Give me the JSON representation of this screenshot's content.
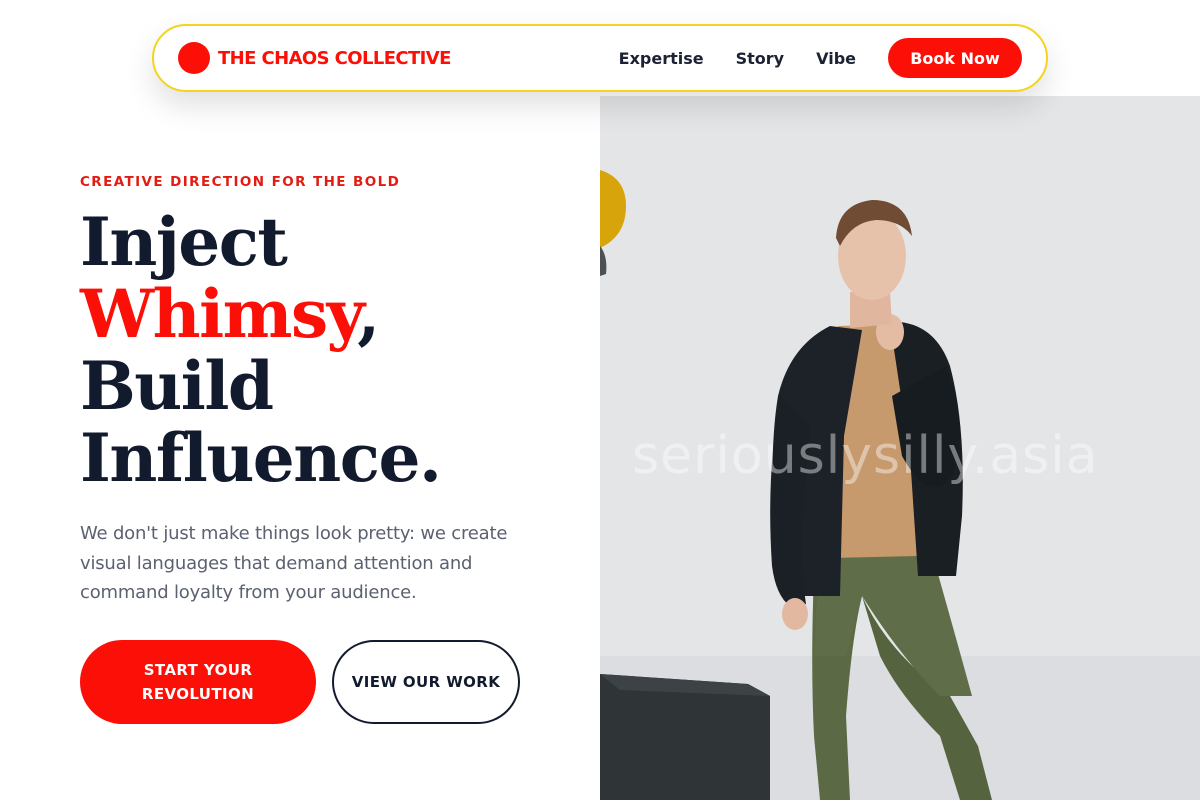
{
  "nav": {
    "brand": "THE CHAOS COLLECTIVE",
    "links": [
      "Expertise",
      "Story",
      "Vibe"
    ],
    "cta": "Book Now"
  },
  "hero": {
    "eyebrow": "CREATIVE DIRECTION FOR THE BOLD",
    "headline": {
      "line1": "Inject",
      "accent": "Whimsy",
      "accent_suffix": ",",
      "line3": "Build",
      "line4": "Influence."
    },
    "lede": "We don't just make things look pretty: we create visual languages that demand attention and command loyalty from your audience.",
    "primary_cta": "START YOUR REVOLUTION",
    "secondary_cta": "VIEW OUR WORK"
  },
  "photo": {
    "watermark": "seriouslysilly.asia"
  },
  "colors": {
    "accent": "#fb0f07",
    "nav_border": "#f3d41e",
    "ink": "#121a2e",
    "body_text": "#5b6170"
  }
}
